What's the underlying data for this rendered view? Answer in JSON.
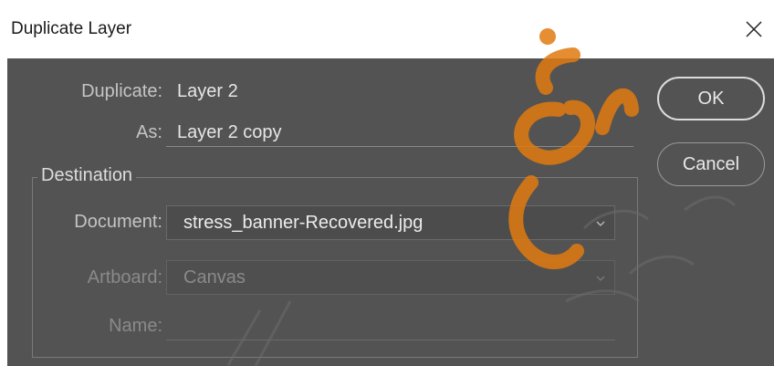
{
  "window": {
    "title": "Duplicate Layer"
  },
  "form": {
    "duplicate_label": "Duplicate:",
    "duplicate_value": "Layer 2",
    "as_label": "As:",
    "as_value": "Layer 2 copy"
  },
  "destination": {
    "legend": "Destination",
    "document_label": "Document:",
    "document_value": "stress_banner-Recovered.jpg",
    "artboard_label": "Artboard:",
    "artboard_value": "Canvas",
    "name_label": "Name:",
    "name_value": ""
  },
  "buttons": {
    "ok": "OK",
    "cancel": "Cancel"
  },
  "colors": {
    "dialog_bg": "#535353",
    "watermark": "#e07a10"
  },
  "icons": [
    "close-icon",
    "chevron-down-icon"
  ]
}
